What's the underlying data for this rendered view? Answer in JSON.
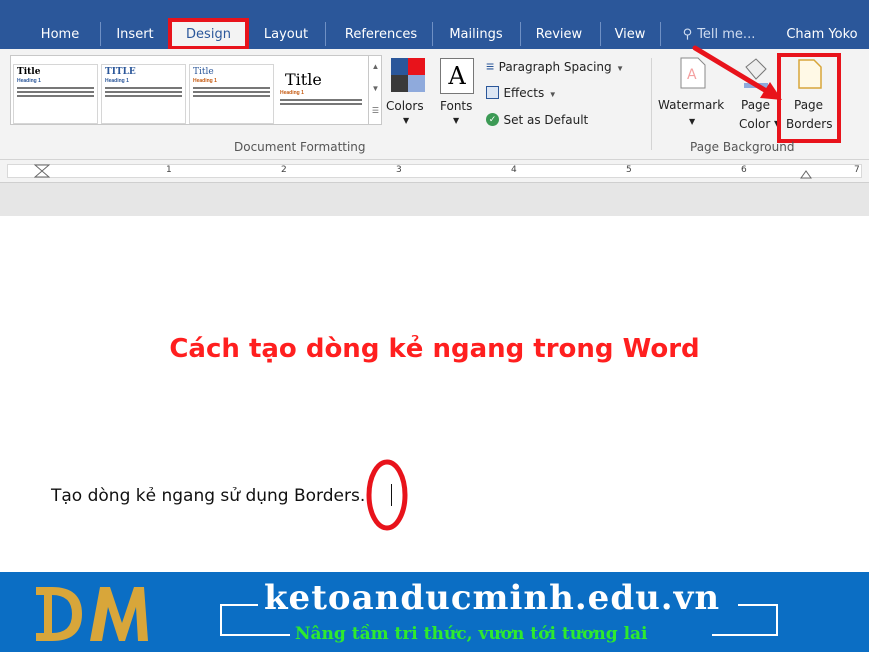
{
  "ribbon_tabs": {
    "home": "Home",
    "insert": "Insert",
    "design": "Design",
    "layout": "Layout",
    "references": "References",
    "mailings": "Mailings",
    "review": "Review",
    "view": "View",
    "tell_me": "Tell me...",
    "user": "Cham Yoko"
  },
  "document_formatting": {
    "style_titles": [
      "Title",
      "TITLE",
      "Title",
      "Title"
    ],
    "heading_sample": "Heading 1",
    "colors_label": "Colors",
    "fonts_label": "Fonts",
    "fonts_glyph": "A",
    "paragraph_spacing": "Paragraph Spacing",
    "effects": "Effects",
    "set_as_default": "Set as Default",
    "group_label": "Document Formatting"
  },
  "page_background": {
    "watermark": "Watermark",
    "page_color_1": "Page",
    "page_color_2": "Color",
    "page_borders_1": "Page",
    "page_borders_2": "Borders",
    "group_label": "Page Background"
  },
  "ruler_numbers": [
    "1",
    "2",
    "3",
    "4",
    "5",
    "6",
    "7"
  ],
  "document": {
    "heading": "Cách tạo dòng kẻ ngang trong Word",
    "body_line": "Tạo  dòng kẻ ngang sử dụng Borders."
  },
  "banner": {
    "site": "ketoanducminh.edu.vn",
    "slogan": "Nâng tầm tri thức, vươn tới tương lai"
  },
  "colors": {
    "ribbon_blue": "#2b579a",
    "highlight_red": "#e8131b",
    "heading_red": "#ff1f1f",
    "banner_blue": "#0b6ec4",
    "slogan_green": "#2eea2e",
    "logo_gold": "#d8a63a"
  }
}
